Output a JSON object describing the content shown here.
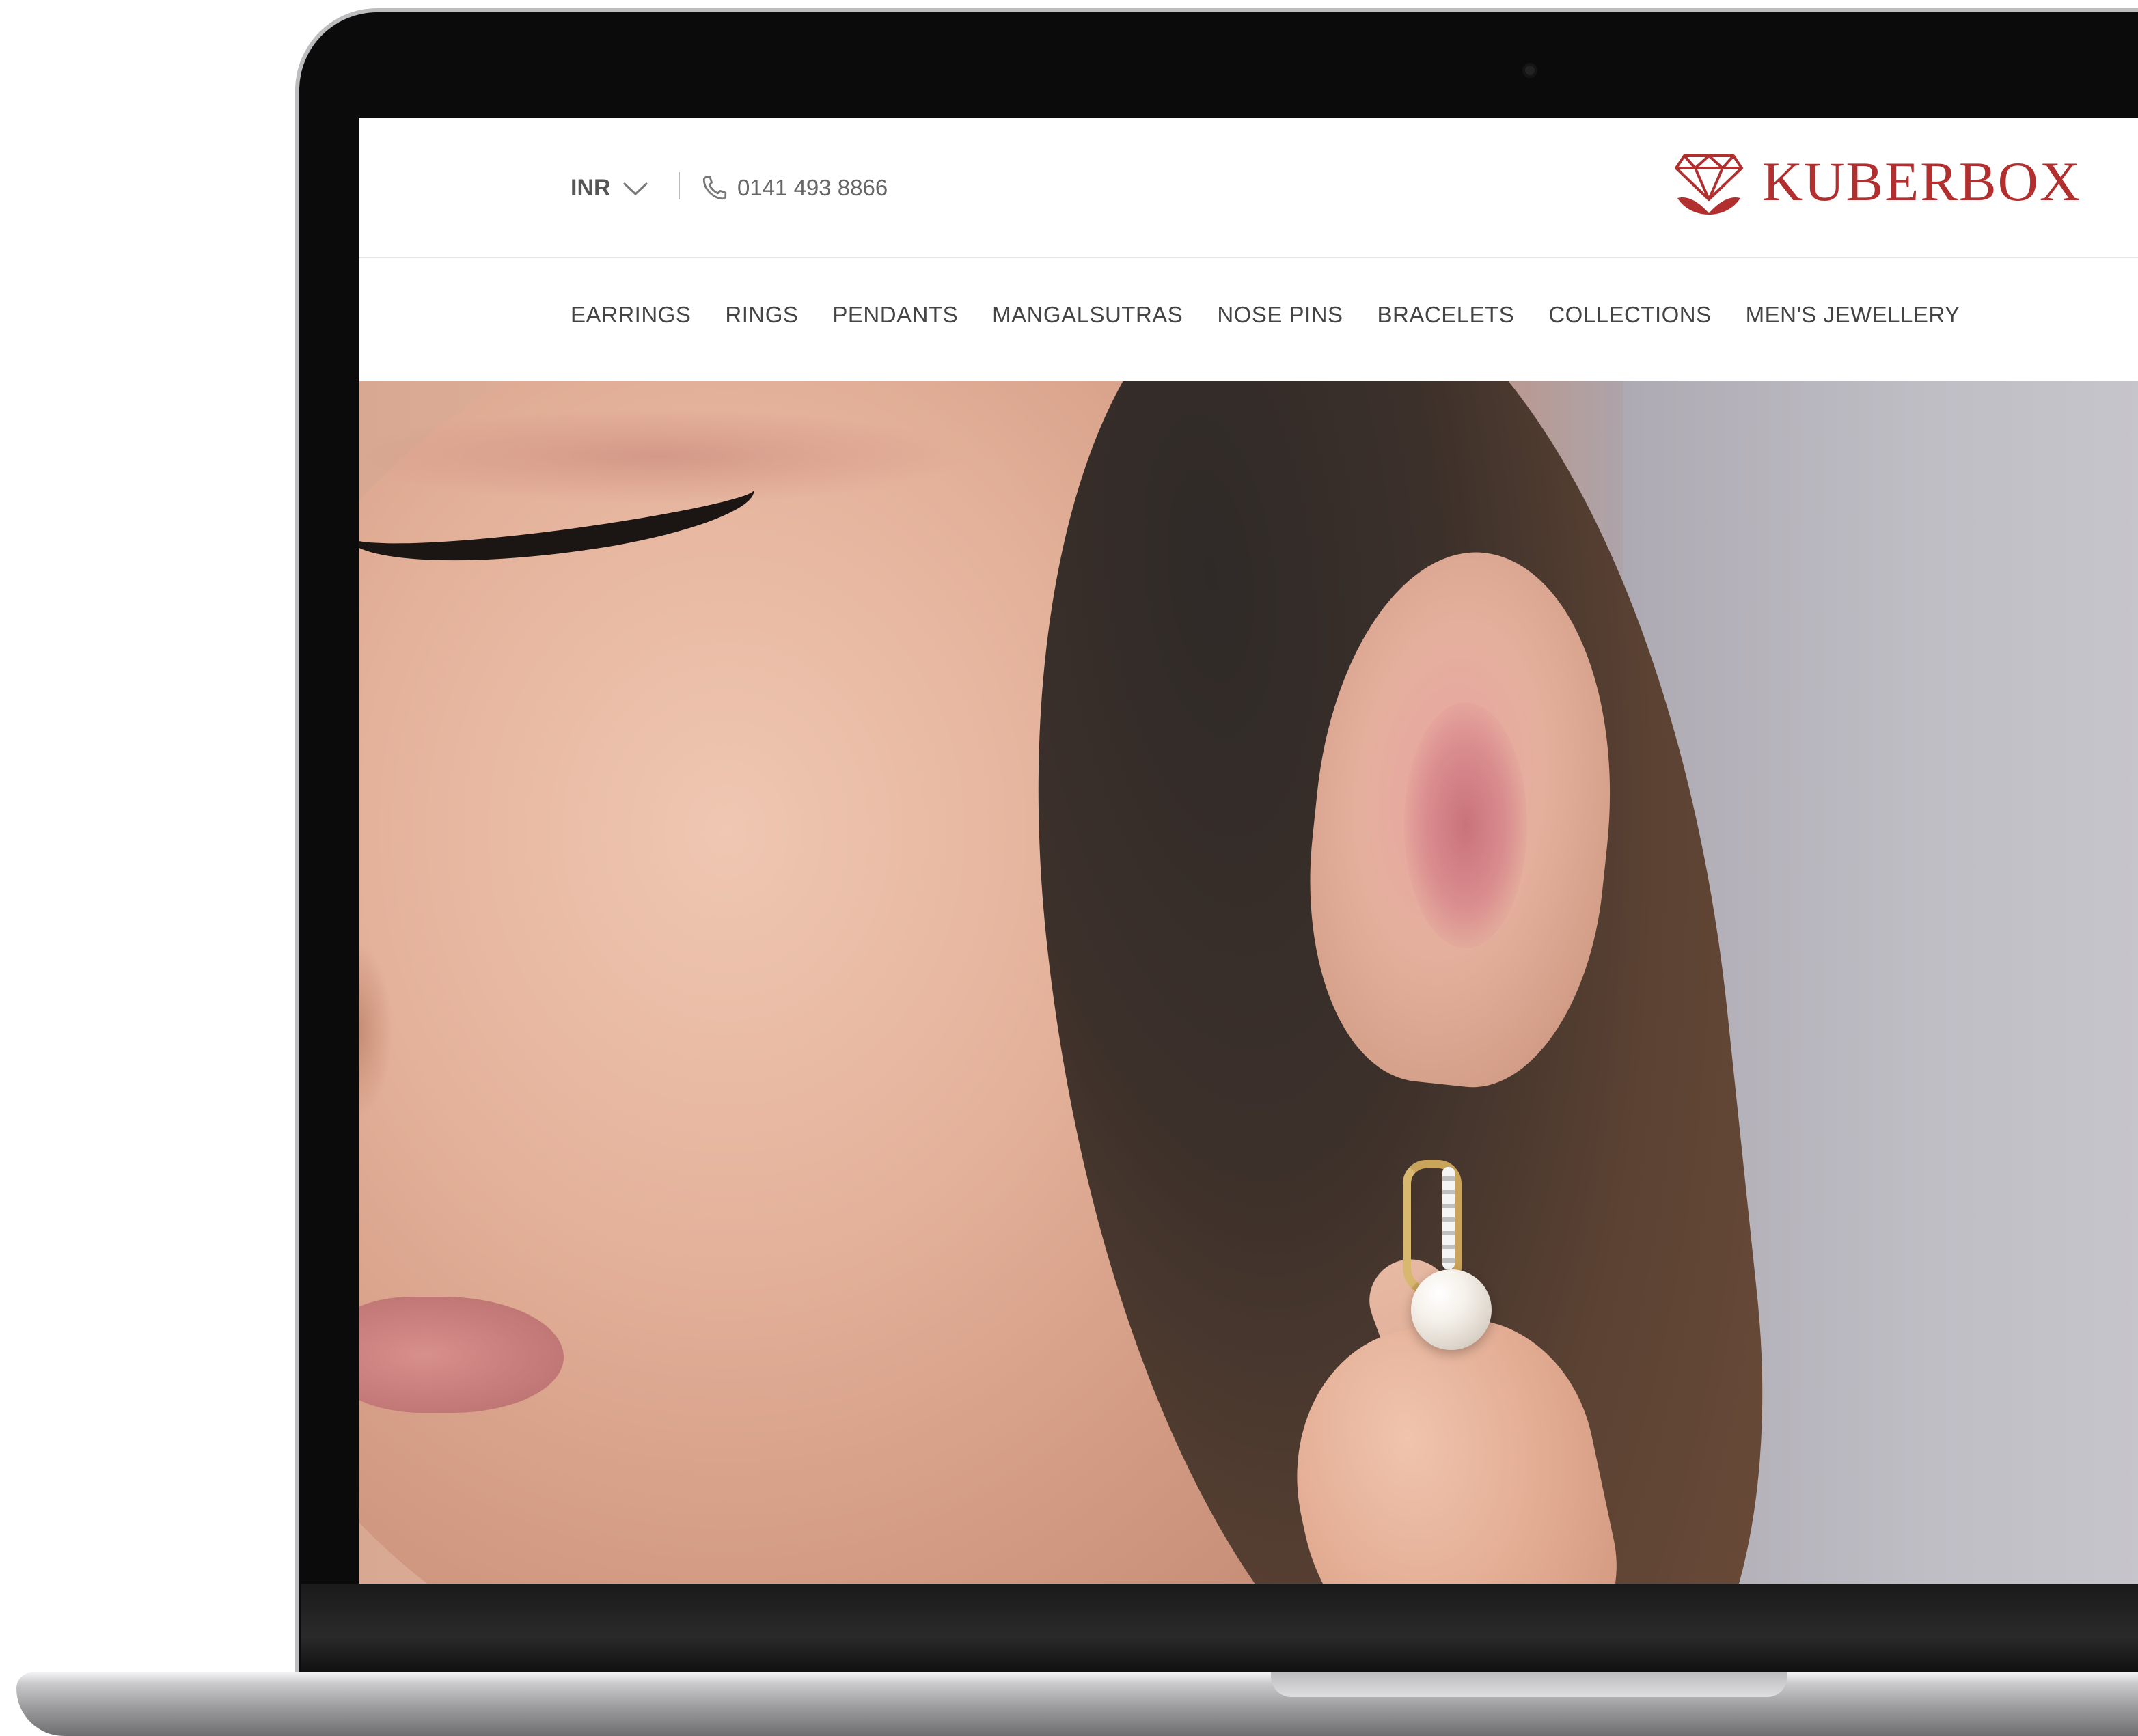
{
  "header": {
    "currency": "INR",
    "phone": "0141 493 8866",
    "brand": "KUBERBOX"
  },
  "nav": {
    "items": [
      "EARRINGS",
      "RINGS",
      "PENDANTS",
      "MANGALSUTRAS",
      "NOSE PINS",
      "BRACELETS",
      "COLLECTIONS",
      "MEN'S JEWELLERY"
    ]
  },
  "icons": {
    "currency_dropdown": "chevron-down-icon",
    "phone": "phone-icon",
    "logo": "diamond-lotus-logo-icon"
  },
  "colors": {
    "brand": "#b12f2f",
    "nav_text": "#444444",
    "header_text": "#555555"
  }
}
